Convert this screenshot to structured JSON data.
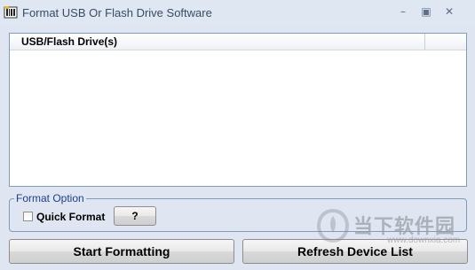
{
  "window": {
    "title": "Format USB Or Flash Drive Software",
    "minimize_icon": "minimize-icon",
    "maximize_icon": "maximize-icon",
    "close_icon": "close-icon"
  },
  "device_list": {
    "columns": [
      "USB/Flash Drive(s)"
    ],
    "rows": []
  },
  "format_option": {
    "legend": "Format Option",
    "quick_format_label": "Quick Format",
    "quick_format_checked": false,
    "help_label": "?"
  },
  "actions": {
    "start_label": "Start Formatting",
    "refresh_label": "Refresh Device List"
  },
  "watermark": {
    "text": "当下软件园",
    "url": "www.downxia.com"
  },
  "colors": {
    "background": "#dfe6f1",
    "legend_text": "#1b3f8f",
    "border": "#7f9db9"
  }
}
